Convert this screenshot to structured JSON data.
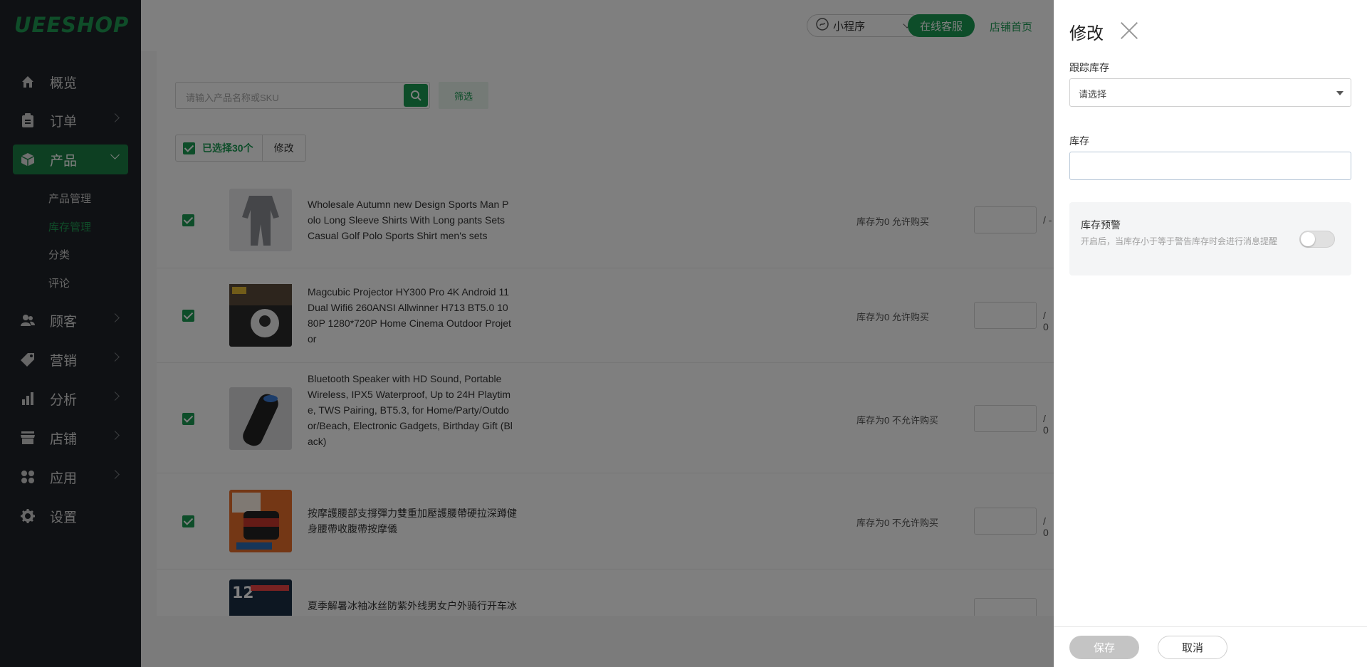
{
  "brand": {
    "logo": "UEESHOP",
    "accent": "#1a9a52"
  },
  "sidebar": {
    "items": [
      {
        "label": "概览",
        "icon": "home-icon"
      },
      {
        "label": "订单",
        "icon": "clipboard-icon"
      },
      {
        "label": "产品",
        "icon": "box-icon"
      },
      {
        "label": "顾客",
        "icon": "users-icon"
      },
      {
        "label": "营销",
        "icon": "tag-icon"
      },
      {
        "label": "分析",
        "icon": "bar-chart-icon"
      },
      {
        "label": "店铺",
        "icon": "store-icon"
      },
      {
        "label": "应用",
        "icon": "apps-icon"
      },
      {
        "label": "设置",
        "icon": "gear-icon"
      }
    ],
    "sub_items": [
      "产品管理",
      "库存管理",
      "分类",
      "评论"
    ]
  },
  "header": {
    "mini_program": "小程序",
    "online_service": "在线客服",
    "store_home": "店铺首页"
  },
  "toolbar": {
    "search_placeholder": "请输入产品名称或SKU",
    "filter_label": "筛选",
    "selected_label": "已选择30个",
    "edit_label": "修改"
  },
  "products": [
    {
      "title": "Wholesale Autumn new Design Sports Man P olo Long Sleeve Shirts With Long pants Sets Casual Golf Polo Sports Shirt men's sets",
      "stock": "库存为0 允许购买",
      "slash": "/ -"
    },
    {
      "title": "Magcubic Projector HY300 Pro 4K Android 11 Dual Wifi6 260ANSI Allwinner H713 BT5.0 10 80P 1280*720P Home Cinema Outdoor Projet or",
      "stock": "库存为0 允许购买",
      "slash": "/ 0"
    },
    {
      "title": "Bluetooth Speaker with HD Sound, Portable Wireless, IPX5 Waterproof, Up to 24H Playtim e, TWS Pairing, BT5.3, for Home/Party/Outdo or/Beach, Electronic Gadgets, Birthday Gift (Bl ack)",
      "stock": "库存为0 不允许购买",
      "slash": "/ 0"
    },
    {
      "title": "按摩護腰部支撐彈力雙重加壓護腰帶硬拉深蹲健身腰帶收腹帶按摩儀",
      "stock": "库存为0 不允许购买",
      "slash": "/ 0"
    },
    {
      "title": "夏季解暑冰袖冰丝防紫外线男女户外骑行开车冰袖",
      "stock": "",
      "slash": ""
    }
  ],
  "drawer": {
    "title": "修改",
    "track_label": "跟踪库存",
    "track_value": "请选择",
    "stock_label": "库存",
    "stock_value": "",
    "warn_title": "库存预警",
    "warn_desc": "开启后，当库存小于等于警告库存时会进行消息提醒",
    "warn_enabled": false,
    "save_label": "保存",
    "cancel_label": "取消"
  }
}
